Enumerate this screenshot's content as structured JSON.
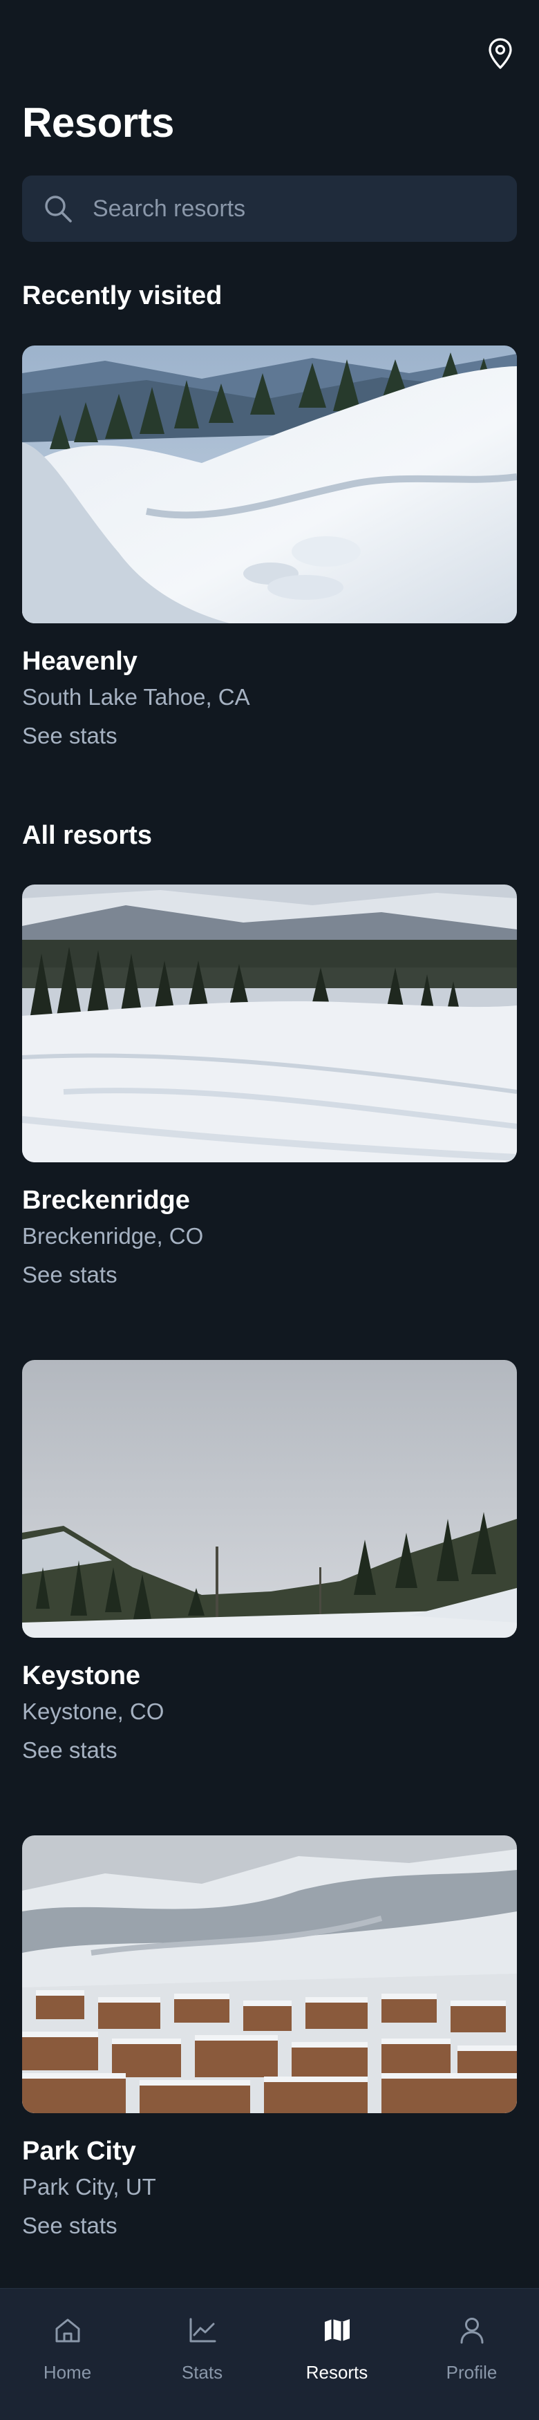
{
  "header": {
    "title": "Resorts",
    "location_icon": "map-pin-icon"
  },
  "search": {
    "placeholder": "Search resorts",
    "value": "",
    "icon": "search-icon"
  },
  "recently_visited": {
    "heading": "Recently visited",
    "items": [
      {
        "name": "Heavenly",
        "location": "South Lake Tahoe, CA",
        "link": "See stats"
      }
    ]
  },
  "all_resorts": {
    "heading": "All resorts",
    "items": [
      {
        "name": "Breckenridge",
        "location": "Breckenridge, CO",
        "link": "See stats"
      },
      {
        "name": "Keystone",
        "location": "Keystone, CO",
        "link": "See stats"
      },
      {
        "name": "Park City",
        "location": "Park City, UT",
        "link": "See stats"
      }
    ]
  },
  "bottom_nav": {
    "items": [
      {
        "label": "Home",
        "icon": "home-icon",
        "active": false
      },
      {
        "label": "Stats",
        "icon": "chart-icon",
        "active": false
      },
      {
        "label": "Resorts",
        "icon": "map-icon",
        "active": true
      },
      {
        "label": "Profile",
        "icon": "user-icon",
        "active": false
      }
    ]
  },
  "colors": {
    "background": "#111820",
    "surface": "#1f2b3b",
    "nav_background": "#1b2433",
    "text_primary": "#ffffff",
    "text_secondary": "#a6b2c2"
  }
}
